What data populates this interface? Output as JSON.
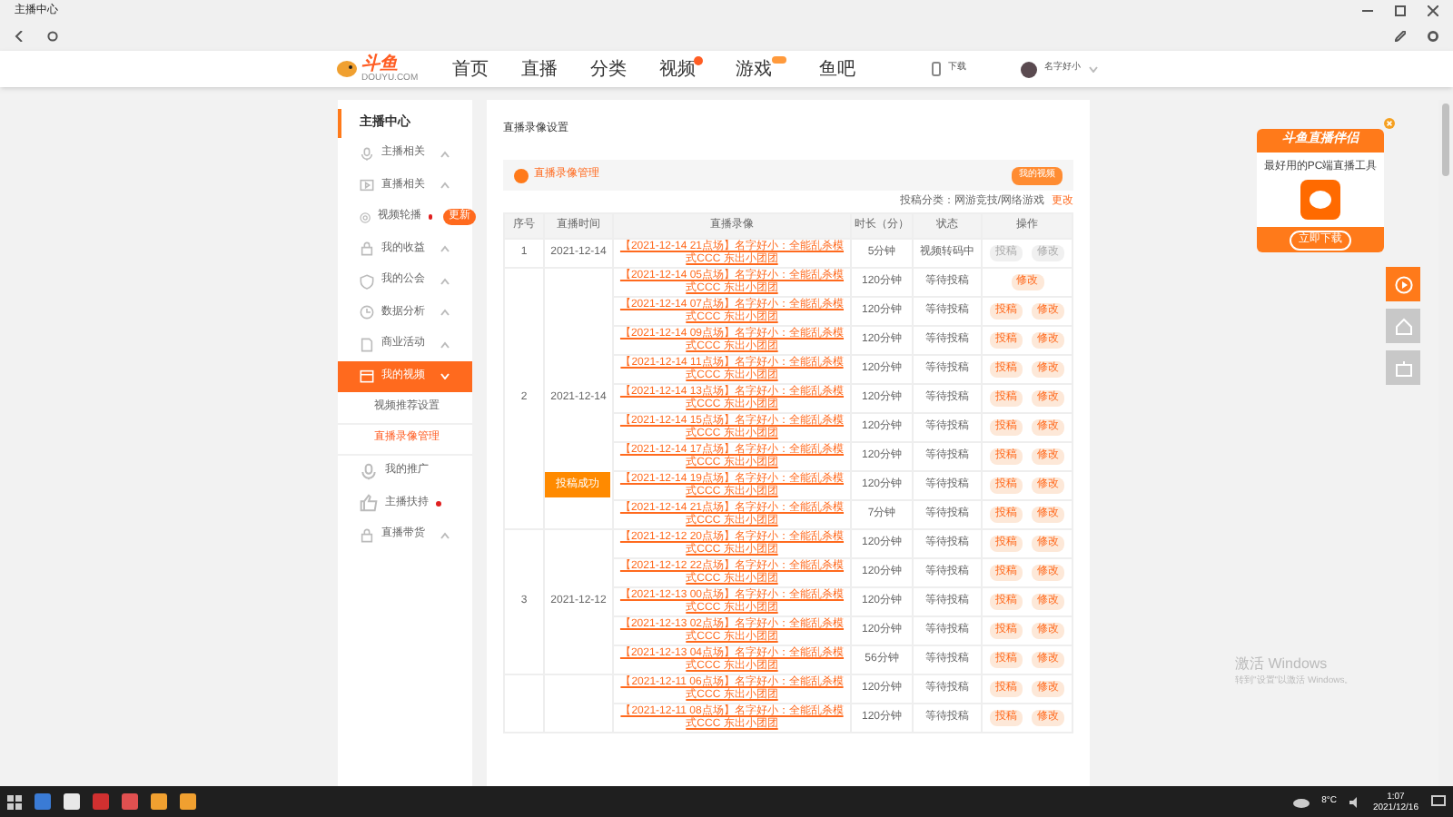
{
  "window": {
    "title": "主播中心"
  },
  "header": {
    "logo": "斗鱼",
    "logo_sub": "DOUYU.COM",
    "nav": [
      {
        "label": "首页",
        "badge": false,
        "new": false
      },
      {
        "label": "直播",
        "badge": false,
        "new": false
      },
      {
        "label": "分类",
        "badge": false,
        "new": false
      },
      {
        "label": "视频",
        "badge": true,
        "new": false
      },
      {
        "label": "游戏",
        "badge": false,
        "new": true
      },
      {
        "label": "鱼吧",
        "badge": false,
        "new": false
      }
    ],
    "download": "下载",
    "user": "名字好小"
  },
  "sidebar": {
    "title": "主播中心",
    "items": [
      {
        "label": "主播相关",
        "expanded": false,
        "dot": false,
        "selected": false
      },
      {
        "label": "直播相关",
        "expanded": false,
        "dot": false,
        "selected": false
      },
      {
        "label": "视频轮播",
        "dot": true,
        "tag": "更新",
        "selected": false
      },
      {
        "label": "我的收益",
        "expanded": false,
        "dot": false,
        "selected": false
      },
      {
        "label": "我的公会",
        "expanded": false,
        "dot": false,
        "selected": false
      },
      {
        "label": "数据分析",
        "expanded": false,
        "dot": false,
        "selected": false
      },
      {
        "label": "商业活动",
        "expanded": false,
        "dot": false,
        "selected": false
      },
      {
        "label": "我的视频",
        "expanded": true,
        "dot": false,
        "selected": true,
        "children": [
          {
            "label": "视频推荐设置",
            "selected": false
          },
          {
            "label": "直播录像管理",
            "selected": true
          }
        ]
      },
      {
        "label": "我的推广",
        "dot": false,
        "selected": false
      },
      {
        "label": "主播扶持",
        "dot": true,
        "selected": false
      },
      {
        "label": "直播带货",
        "expanded": false,
        "dot": false,
        "selected": false
      }
    ]
  },
  "main": {
    "title": "直播录像设置",
    "section": "直播录像管理",
    "section_button": "我的视频",
    "category_label": "投稿分类：网游竞技/网络游戏",
    "category_action": "更改",
    "columns": [
      "序号",
      "直播时间",
      "直播录像",
      "时长（分）",
      "状态",
      "操作"
    ],
    "groups": [
      {
        "index": "1",
        "date": "2021-12-14",
        "rows": [
          {
            "title": "【2021-12-14 21点场】名字好小：全能乱杀模式CCC 东出小团团",
            "duration": "5分钟",
            "status": "视频转码中",
            "actions": [
              {
                "label": "投稿",
                "disabled": true
              },
              {
                "label": "修改",
                "disabled": true
              }
            ]
          }
        ]
      },
      {
        "index": "2",
        "date": "2021-12-14",
        "rows": [
          {
            "title": "【2021-12-14 05点场】名字好小：全能乱杀模式CCC 东出小团团",
            "duration": "120分钟",
            "status": "等待投稿",
            "actions": [
              {
                "label": "修改",
                "disabled": false
              }
            ]
          },
          {
            "title": "【2021-12-14 07点场】名字好小：全能乱杀模式CCC 东出小团团",
            "duration": "120分钟",
            "status": "等待投稿",
            "actions": [
              {
                "label": "投稿",
                "disabled": false
              },
              {
                "label": "修改",
                "disabled": false
              }
            ]
          },
          {
            "title": "【2021-12-14 09点场】名字好小：全能乱杀模式CCC 东出小团团",
            "duration": "120分钟",
            "status": "等待投稿",
            "actions": [
              {
                "label": "投稿",
                "disabled": false
              },
              {
                "label": "修改",
                "disabled": false
              }
            ]
          },
          {
            "title": "【2021-12-14 11点场】名字好小：全能乱杀模式CCC 东出小团团",
            "duration": "120分钟",
            "status": "等待投稿",
            "actions": [
              {
                "label": "投稿",
                "disabled": false
              },
              {
                "label": "修改",
                "disabled": false
              }
            ]
          },
          {
            "title": "【2021-12-14 13点场】名字好小：全能乱杀模式CCC 东出小团团",
            "duration": "120分钟",
            "status": "等待投稿",
            "actions": [
              {
                "label": "投稿",
                "disabled": false
              },
              {
                "label": "修改",
                "disabled": false
              }
            ]
          },
          {
            "title": "【2021-12-14 15点场】名字好小：全能乱杀模式CCC 东出小团团",
            "duration": "120分钟",
            "status": "等待投稿",
            "actions": [
              {
                "label": "投稿",
                "disabled": false
              },
              {
                "label": "修改",
                "disabled": false
              }
            ]
          },
          {
            "title": "【2021-12-14 17点场】名字好小：全能乱杀模式CCC 东出小团团",
            "duration": "120分钟",
            "status": "等待投稿",
            "actions": [
              {
                "label": "投稿",
                "disabled": false
              },
              {
                "label": "修改",
                "disabled": false
              }
            ]
          },
          {
            "title": "【2021-12-14 19点场】名字好小：全能乱杀模式CCC 东出小团团",
            "duration": "120分钟",
            "status": "等待投稿",
            "actions": [
              {
                "label": "投稿",
                "disabled": false
              },
              {
                "label": "修改",
                "disabled": false
              }
            ]
          },
          {
            "title": "【2021-12-14 21点场】名字好小：全能乱杀模式CCC 东出小团团",
            "duration": "7分钟",
            "status": "等待投稿",
            "actions": [
              {
                "label": "投稿",
                "disabled": false
              },
              {
                "label": "修改",
                "disabled": false
              }
            ]
          }
        ]
      },
      {
        "index": "3",
        "date": "2021-12-12",
        "rows": [
          {
            "title": "【2021-12-12 20点场】名字好小：全能乱杀模式CCC 东出小团团",
            "duration": "120分钟",
            "status": "等待投稿",
            "actions": [
              {
                "label": "投稿",
                "disabled": false
              },
              {
                "label": "修改",
                "disabled": false
              }
            ]
          },
          {
            "title": "【2021-12-12 22点场】名字好小：全能乱杀模式CCC 东出小团团",
            "duration": "120分钟",
            "status": "等待投稿",
            "actions": [
              {
                "label": "投稿",
                "disabled": false
              },
              {
                "label": "修改",
                "disabled": false
              }
            ]
          },
          {
            "title": "【2021-12-13 00点场】名字好小：全能乱杀模式CCC 东出小团团",
            "duration": "120分钟",
            "status": "等待投稿",
            "actions": [
              {
                "label": "投稿",
                "disabled": false
              },
              {
                "label": "修改",
                "disabled": false
              }
            ]
          },
          {
            "title": "【2021-12-13 02点场】名字好小：全能乱杀模式CCC 东出小团团",
            "duration": "120分钟",
            "status": "等待投稿",
            "actions": [
              {
                "label": "投稿",
                "disabled": false
              },
              {
                "label": "修改",
                "disabled": false
              }
            ]
          },
          {
            "title": "【2021-12-13 04点场】名字好小：全能乱杀模式CCC 东出小团团",
            "duration": "56分钟",
            "status": "等待投稿",
            "actions": [
              {
                "label": "投稿",
                "disabled": false
              },
              {
                "label": "修改",
                "disabled": false
              }
            ]
          }
        ]
      },
      {
        "rows": [
          {
            "title": "【2021-12-11 06点场】名字好小：全能乱杀模式CCC 东出小团团",
            "duration": "120分钟",
            "status": "等待投稿",
            "actions": [
              {
                "label": "投稿",
                "disabled": false
              },
              {
                "label": "修改",
                "disabled": false
              }
            ]
          },
          {
            "title": "【2021-12-11 08点场】名字好小：全能乱杀模式CCC 东出小团团",
            "duration": "120分钟",
            "status": "等待投稿",
            "actions": [
              {
                "label": "投稿",
                "disabled": false
              },
              {
                "label": "修改",
                "disabled": false
              }
            ]
          }
        ]
      }
    ]
  },
  "toast": "投稿成功",
  "ad": {
    "title": "斗鱼直播伴侣",
    "subtitle": "最好用的PC端直播工具",
    "button": "立即下载"
  },
  "watermark": {
    "title": "激活 Windows",
    "text": "转到\"设置\"以激活 Windows。"
  },
  "taskbar": {
    "weather": "8°C",
    "time": "1:07",
    "date": "2021/12/16"
  }
}
